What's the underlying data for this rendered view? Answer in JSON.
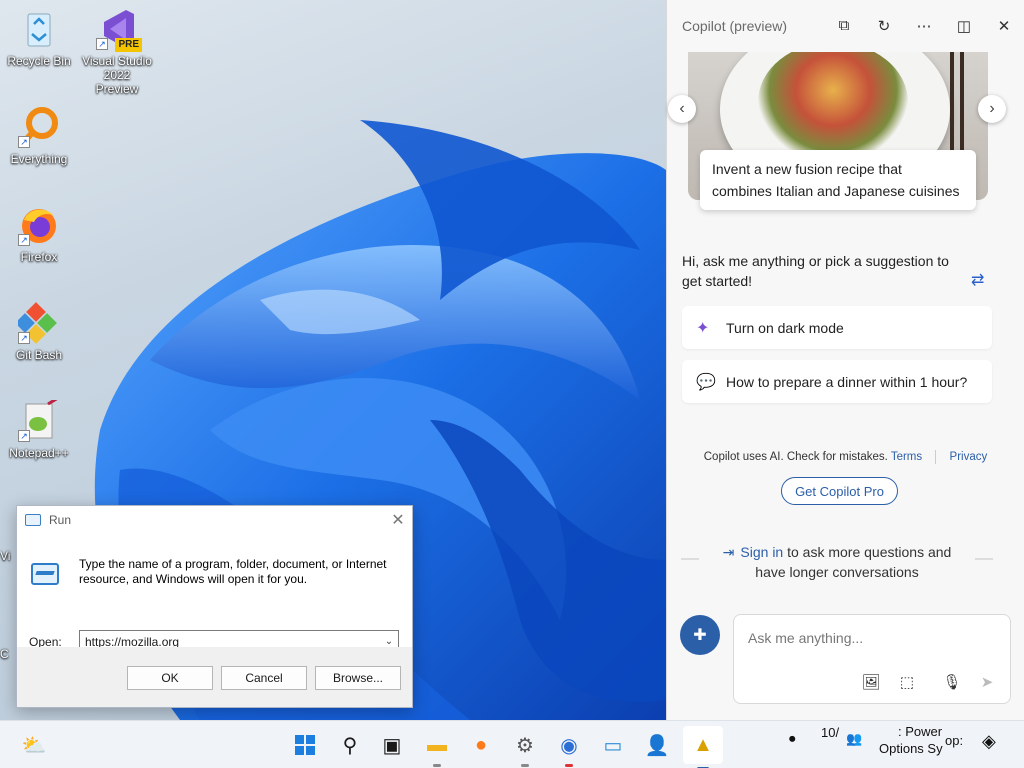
{
  "desktop": {
    "icons": [
      {
        "label": "Recycle Bin",
        "icon": "recycle-bin-icon"
      },
      {
        "label": "Visual Studio 2022 Preview",
        "icon": "visual-studio-icon",
        "badge": "PRE"
      },
      {
        "label": "Everything",
        "icon": "everything-search-icon"
      },
      {
        "label": "Firefox",
        "icon": "firefox-icon"
      },
      {
        "label": "Git Bash",
        "icon": "git-bash-icon"
      },
      {
        "label": "Notepad++",
        "icon": "notepad-plus-plus-icon"
      }
    ],
    "partial_labels": [
      "Vi",
      "C"
    ]
  },
  "run_dialog": {
    "title": "Run",
    "description": "Type the name of a program, folder, document, or Internet resource, and Windows will open it for you.",
    "open_label_prefix": "",
    "open_label_underline": "O",
    "open_label_rest": "pen:",
    "open_value": "https://mozilla.org",
    "ok_label": "OK",
    "cancel_label": "Cancel",
    "browse_label": "Browse..."
  },
  "copilot": {
    "title": "Copilot (preview)",
    "card_caption": "Invent a new fusion recipe that combines Italian and Japanese cuisines",
    "greeting": "Hi, ask me anything or pick a suggestion to get started!",
    "suggestions": [
      {
        "label": "Turn on dark mode",
        "icon": "sparkle-icon"
      },
      {
        "label": "How to prepare a dinner within 1 hour?",
        "icon": "chat-bubbles-icon"
      }
    ],
    "legal_text": "Copilot uses AI. Check for mistakes.",
    "terms_label": "Terms",
    "privacy_label": "Privacy",
    "pro_button": "Get Copilot Pro",
    "signin_link": "Sign in",
    "signin_rest": "to ask more questions and have longer conversations",
    "input_placeholder": "Ask me anything..."
  },
  "taskbar": {
    "tray_text_1": "10/",
    "tray_text_2": ": Power",
    "tray_text_3": "Options Sy",
    "tray_text_4": "op:"
  },
  "colors": {
    "accent": "#2b5fa8",
    "wallpaper_blue": "#1f6fe8"
  }
}
